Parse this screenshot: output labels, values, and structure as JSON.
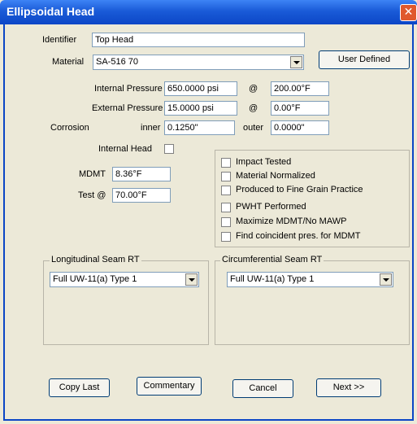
{
  "window": {
    "title": "Ellipsoidal Head",
    "close_glyph": "✕"
  },
  "identifier": {
    "label": "Identifier",
    "value": "Top Head"
  },
  "material": {
    "label": "Material",
    "value": "SA-516 70",
    "user_defined_button": "User Defined"
  },
  "internal_pressure": {
    "label": "Internal Pressure",
    "value": "650.0000 psi",
    "at": "@",
    "temp": "200.00°F"
  },
  "external_pressure": {
    "label": "External Pressure",
    "value": "15.0000 psi",
    "at": "@",
    "temp": "0.00°F"
  },
  "corrosion": {
    "label": "Corrosion",
    "inner_label": "inner",
    "inner_value": "0.1250\"",
    "outer_label": "outer",
    "outer_value": "0.0000\""
  },
  "internal_head": {
    "label": "Internal Head",
    "checked": false
  },
  "mdmt": {
    "label": "MDMT",
    "value": "8.36°F"
  },
  "test": {
    "label": "Test @",
    "value": "70.00°F"
  },
  "options": [
    {
      "label": "Impact Tested",
      "checked": false
    },
    {
      "label": "Material Normalized",
      "checked": false
    },
    {
      "label": "Produced to Fine Grain Practice",
      "checked": false
    },
    {
      "label": "PWHT Performed",
      "checked": false
    },
    {
      "label": "Maximize MDMT/No MAWP",
      "checked": false
    },
    {
      "label": "Find coincident pres. for MDMT",
      "checked": false
    }
  ],
  "longitudinal_seam": {
    "label": "Longitudinal Seam RT",
    "value": "Full UW-11(a) Type 1"
  },
  "circumferential_seam": {
    "label": "Circumferential Seam RT",
    "value": "Full UW-11(a) Type 1"
  },
  "buttons": {
    "copy_last": "Copy Last",
    "commentary": "Commentary",
    "cancel": "Cancel",
    "next": "Next >>"
  }
}
